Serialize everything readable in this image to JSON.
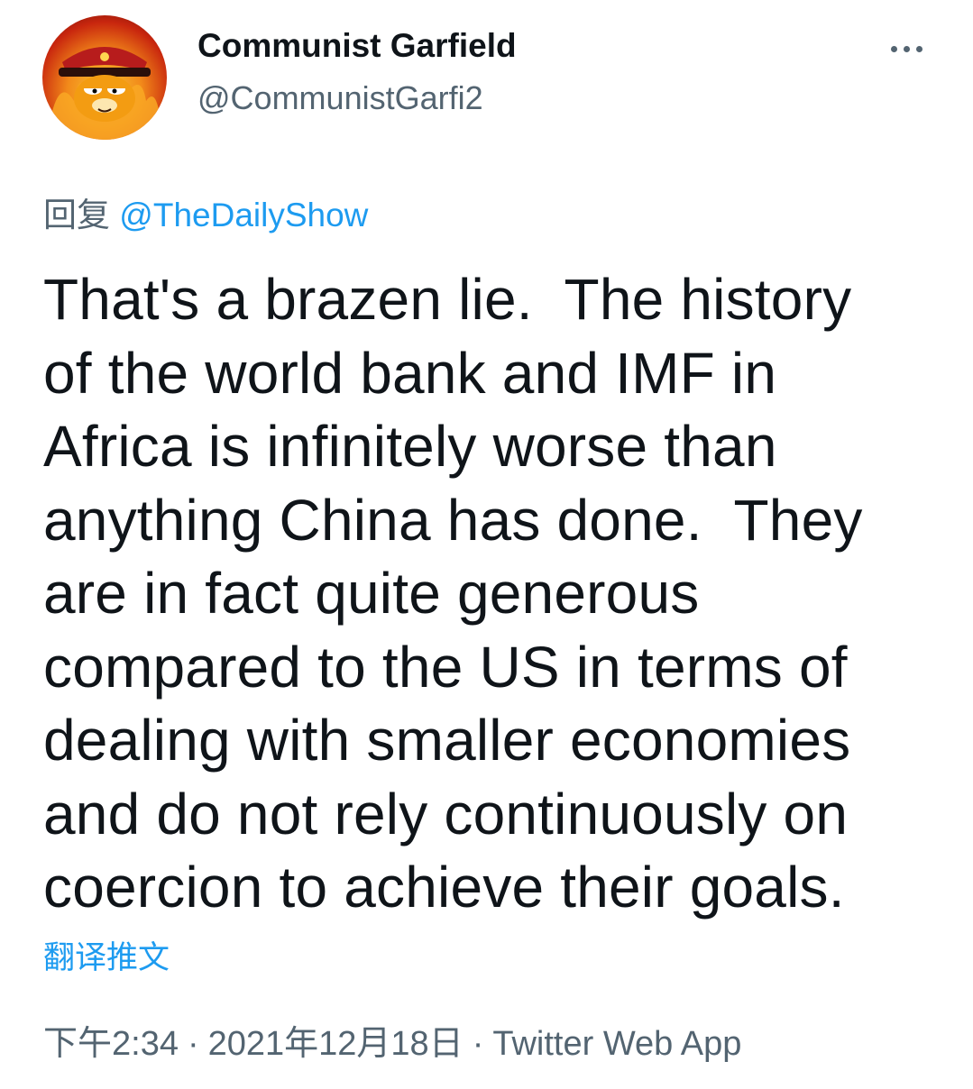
{
  "author": {
    "display_name": "Communist Garfield",
    "handle": "@CommunistGarfi2",
    "avatar_icon": "garfield-soviet-cap-avatar"
  },
  "more_icon": "ellipsis-icon",
  "reply": {
    "prefix": "回复",
    "mention": "@TheDailyShow"
  },
  "tweet": {
    "lines": [
      "That's a brazen lie.  The history",
      "of the world bank and IMF in",
      "Africa is infinitely worse than",
      "anything China has done.  They",
      "are in fact quite generous",
      "compared to the US in terms of",
      "dealing with smaller economies",
      "and do not rely continuously on",
      "coercion to achieve their goals."
    ]
  },
  "translate_label": "翻译推文",
  "meta": {
    "time": "下午2:34",
    "separator": "·",
    "date": "2021年12月18日",
    "source": "Twitter Web App"
  },
  "colors": {
    "text": "#0f1419",
    "secondary": "#536471",
    "link": "#1d9bf0"
  }
}
